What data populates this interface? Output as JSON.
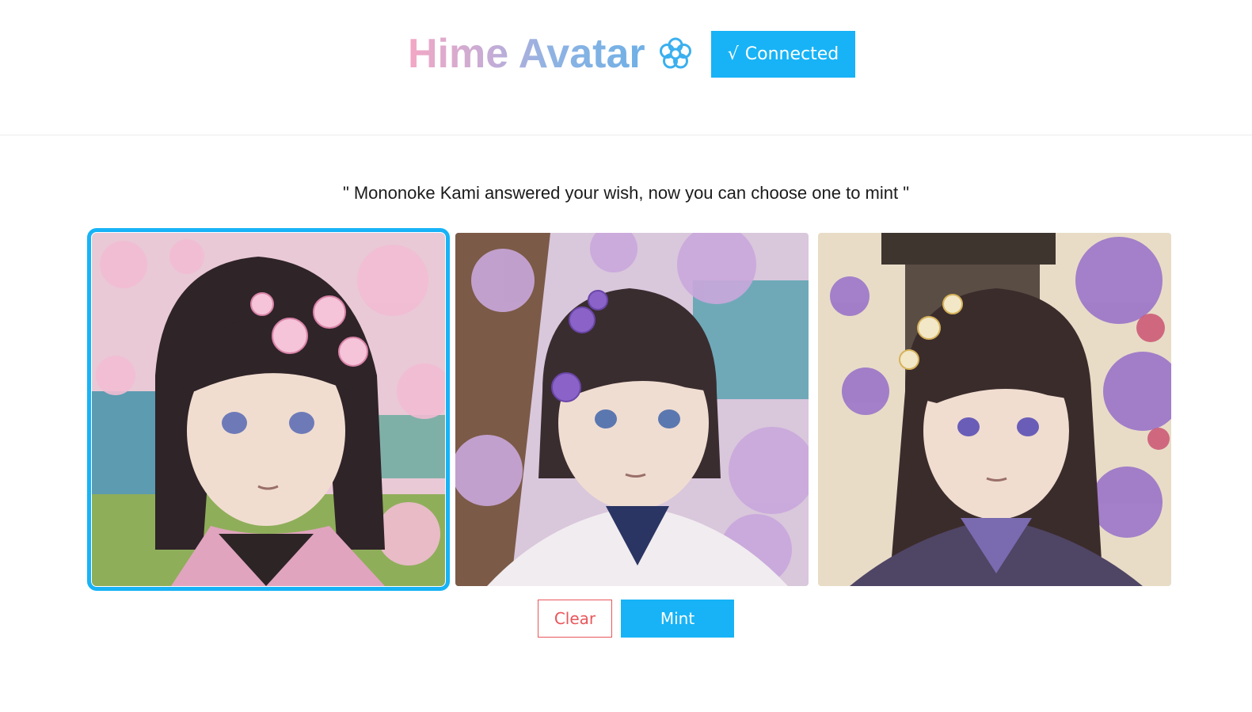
{
  "header": {
    "title": "Hime Avatar",
    "logo_icon": "flower-icon",
    "connect_button": {
      "check": "√",
      "label": "Connected",
      "color": "#17b3f6"
    }
  },
  "main": {
    "prompt": "\" Mononoke Kami answered your wish, now you can choose one to mint \"",
    "avatars": [
      {
        "selected": true
      },
      {
        "selected": false
      },
      {
        "selected": false
      }
    ],
    "actions": {
      "clear_label": "Clear",
      "mint_label": "Mint"
    }
  },
  "colors": {
    "accent": "#17b3f6",
    "danger": "#e9565b",
    "title_gradient": [
      "#f3a8c4",
      "#8fb3e3"
    ]
  }
}
